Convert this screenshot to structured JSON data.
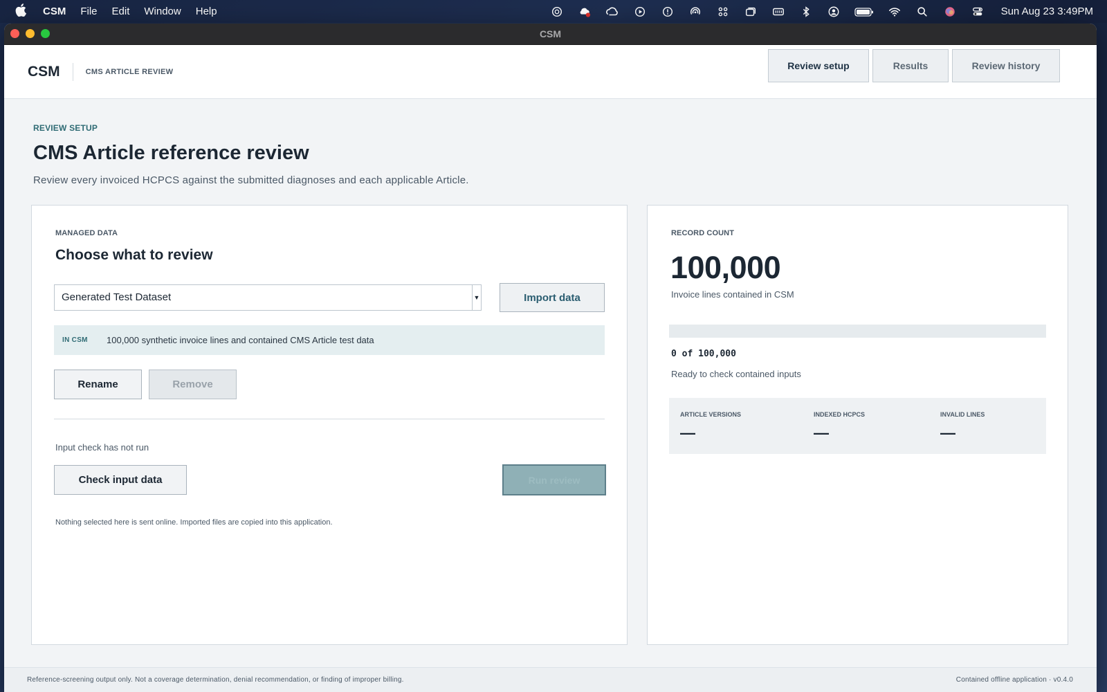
{
  "menubar": {
    "app_name": "CSM",
    "menus": [
      "File",
      "Edit",
      "Window",
      "Help"
    ],
    "clock": "Sun Aug 23  3:49PM",
    "status_icons": [
      "chatgpt-icon",
      "cloud-sync-error-icon",
      "creative-cloud-icon",
      "play-circle-icon",
      "alert-circle-icon",
      "airdrop-icon",
      "grid-icon",
      "window-icon",
      "keyboard-icon",
      "bluetooth-icon",
      "user-icon",
      "battery-icon",
      "wifi-icon",
      "search-icon",
      "siri-icon",
      "control-center-icon"
    ]
  },
  "window": {
    "title": "CSM"
  },
  "header": {
    "brand": "CSM",
    "subtitle": "CMS ARTICLE REVIEW",
    "nav": [
      "Review setup",
      "Results",
      "Review history"
    ],
    "active_nav": "Review setup"
  },
  "page": {
    "eyebrow": "REVIEW SETUP",
    "title": "CMS Article reference review",
    "description": "Review every invoiced HCPCS against the submitted diagnoses and each applicable Article."
  },
  "managed": {
    "label": "MANAGED DATA",
    "title": "Choose what to review",
    "selected_dataset": "Generated Test Dataset",
    "import_label": "Import data",
    "info_tag": "IN CSM",
    "info_text": "100,000 synthetic invoice lines and contained CMS Article test data",
    "rename_label": "Rename",
    "remove_label": "Remove",
    "check_status": "Input check has not run",
    "check_label": "Check input data",
    "run_label": "Run review",
    "footnote": "Nothing selected here is sent online. Imported files are copied into this application."
  },
  "record": {
    "label": "RECORD COUNT",
    "count": "100,000",
    "count_caption": "Invoice lines contained in CSM",
    "progress_fraction": 0,
    "progress_text": "0 of 100,000",
    "progress_status": "Ready to check contained inputs",
    "stats": [
      {
        "label": "ARTICLE VERSIONS",
        "value": "—"
      },
      {
        "label": "INDEXED HCPCS",
        "value": "—"
      },
      {
        "label": "INVALID LINES",
        "value": "—"
      }
    ]
  },
  "footer": {
    "disclaimer": "Reference-screening output only. Not a coverage determination, denial recommendation, or finding of improper billing.",
    "version": "Contained offline application · v0.4.0"
  },
  "colors": {
    "accent": "#2f6b74",
    "text": "#1c2733",
    "muted": "#4a5866",
    "run_button": "#8fb0b6"
  }
}
